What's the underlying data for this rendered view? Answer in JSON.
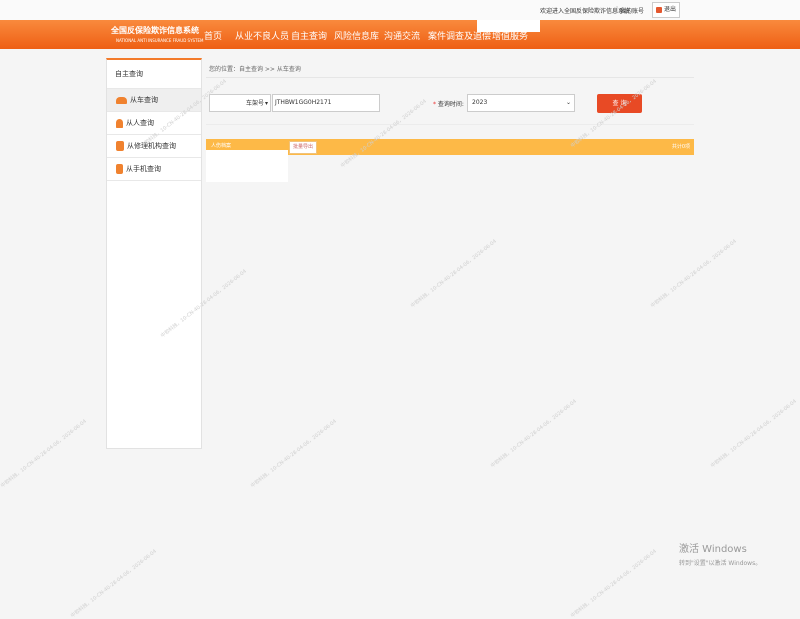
{
  "topbar": {
    "welcome": "欢迎进入全国反保险欺诈信息系统",
    "separator": "|",
    "my_account": "我的账号",
    "quit_label": "退出"
  },
  "logo": {
    "cn": "全国反保险欺诈信息系统",
    "en": "NATIONAL ANTI INSURANCE FRAUD SYSTEM"
  },
  "nav": [
    "首页",
    "从业不良人员",
    "自主查询",
    "风险信息库",
    "沟通交流",
    "案件调查及追偿",
    "增值服务"
  ],
  "sidebar": {
    "title": "自主查询",
    "items": [
      {
        "label": "从车查询",
        "icon": "car-icon",
        "color": "#f0822f"
      },
      {
        "label": "从人查询",
        "icon": "person-icon",
        "color": "#f0822f"
      },
      {
        "label": "从修理机构查询",
        "icon": "repair-icon",
        "color": "#f0822f"
      },
      {
        "label": "从手机查询",
        "icon": "phone-icon",
        "color": "#f0822f"
      }
    ]
  },
  "breadcrumb": "您的位置：自主查询 >> 从车查询",
  "search": {
    "plate_type": "车架号",
    "plate_value": "JTHBW1GG0H2171",
    "time_label": "查询时间:",
    "required_mark": "*",
    "year": "2023",
    "search_button": "查 询"
  },
  "results": {
    "header": "人伤档案",
    "export_button": "批量导出",
    "count": "共计0项"
  },
  "windows": {
    "title": "激活 Windows",
    "subtitle": "转到\"设置\"以激活 Windows。"
  },
  "watermark": "中软科技，10-CN-40-28-04-06，2026-06-04"
}
